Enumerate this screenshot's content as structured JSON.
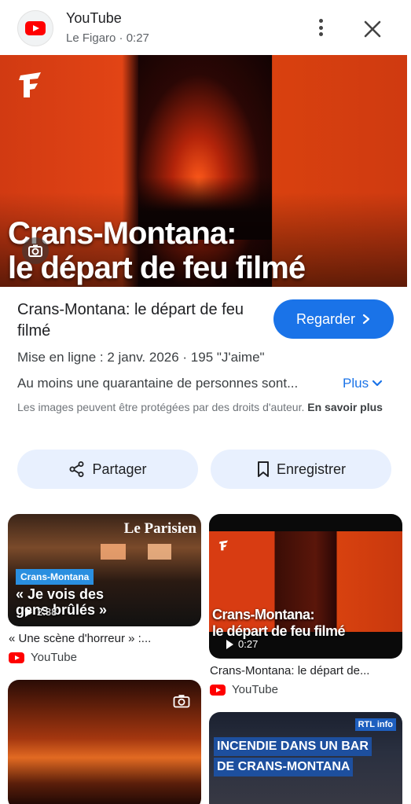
{
  "header": {
    "source_name": "YouTube",
    "source_meta": "Le Figaro · 0:27"
  },
  "hero": {
    "caption_line1": "Crans-Montana:",
    "caption_line2": "le départ de feu filmé"
  },
  "details": {
    "title": "Crans-Montana: le départ de feu filmé",
    "watch_label": "Regarder",
    "meta_line": "Mise en ligne : 2 janv. 2026  ·  195 \"J'aime\"",
    "description": "Au moins une quarantaine de personnes sont...",
    "more_label": "Plus",
    "copyright_text": "Les images peuvent être protégées par des droits d'auteur.",
    "copyright_link": "En savoir plus"
  },
  "actions": {
    "share_label": "Partager",
    "save_label": "Enregistrer"
  },
  "related": [
    {
      "brand": "Le Parisien",
      "tag": "Crans-Montana",
      "quote": "« Je vois des gens brûlés »",
      "duration": "2:38",
      "caption": "« Une scène d'horreur » :...",
      "source": "YouTube"
    },
    {
      "overlay_line1": "Crans-Montana:",
      "overlay_line2": "le départ de feu filmé",
      "duration": "0:27",
      "caption": "Crans-Montana: le départ de...",
      "source": "YouTube"
    },
    {
      "caption": ""
    },
    {
      "badge": "RTL info",
      "banner_line1": "INCENDIE DANS UN BAR",
      "banner_line2": "DE CRANS-MONTANA"
    }
  ],
  "colors": {
    "accent": "#1a73e8",
    "pill_bg": "#e8f0fe",
    "youtube_red": "#ff0000"
  }
}
